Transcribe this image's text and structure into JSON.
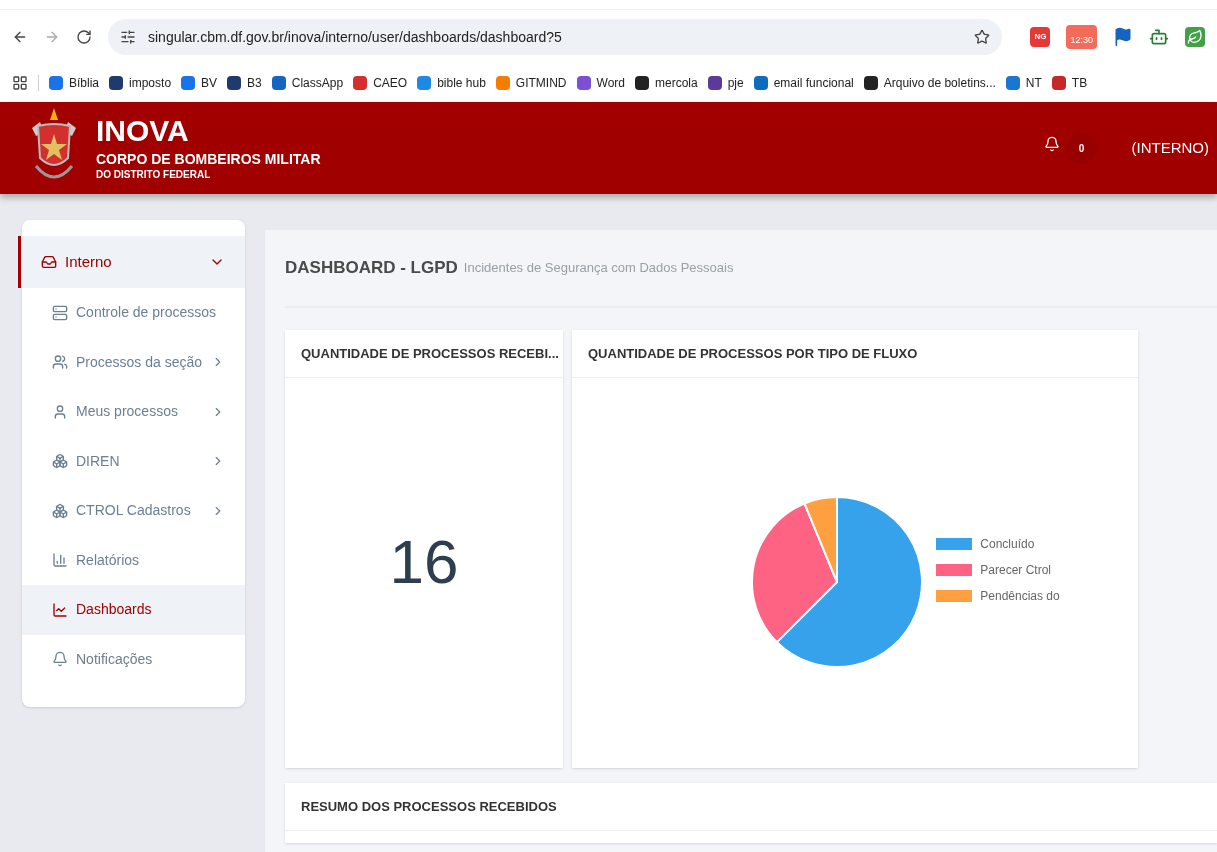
{
  "browser": {
    "url": "singular.cbm.df.gov.br/inova/interno/user/dashboards/dashboard?5",
    "extensions": [
      {
        "kind": "badge",
        "label": "NG"
      },
      {
        "kind": "clock",
        "label": "12:30"
      },
      {
        "kind": "flag"
      },
      {
        "kind": "robot"
      },
      {
        "kind": "leaf"
      }
    ],
    "bookmarks": [
      {
        "label": "Bíblia",
        "color": "#1a73e8"
      },
      {
        "label": "imposto",
        "color": "#1f3b6e"
      },
      {
        "label": "BV",
        "color": "#1a73e8"
      },
      {
        "label": "B3",
        "color": "#1f3b6e"
      },
      {
        "label": "ClassApp",
        "color": "#1565c0"
      },
      {
        "label": "CAEO",
        "color": "#d32f2f"
      },
      {
        "label": "bible hub",
        "color": "#1e88e5"
      },
      {
        "label": "GITMIND",
        "color": "#f57c00"
      },
      {
        "label": "Word",
        "color": "#7b4fd6"
      },
      {
        "label": "mercola",
        "color": "#222222"
      },
      {
        "label": "pje",
        "color": "#5b3a99"
      },
      {
        "label": "email funcional",
        "color": "#0f6cbd"
      },
      {
        "label": "Arquivo de boletins...",
        "color": "#222222"
      },
      {
        "label": "NT",
        "color": "#1976d2"
      },
      {
        "label": "TB",
        "color": "#c62828"
      }
    ]
  },
  "header": {
    "title": "INOVA",
    "subtitle": "CORPO DE BOMBEIROS MILITAR",
    "subtitle2": "DO DISTRITO FEDERAL",
    "notification_count": "0",
    "user": "(INTERNO)"
  },
  "sidebar": {
    "group": {
      "label": "Interno",
      "expanded": true
    },
    "items": [
      {
        "label": "Controle de processos",
        "has_children": false,
        "selected": false
      },
      {
        "label": "Processos da seção",
        "has_children": true,
        "selected": false
      },
      {
        "label": "Meus processos",
        "has_children": true,
        "selected": false
      },
      {
        "label": "DIREN",
        "has_children": true,
        "selected": false
      },
      {
        "label": "CTROL Cadastros",
        "has_children": true,
        "selected": false
      },
      {
        "label": "Relatórios",
        "has_children": false,
        "selected": false
      },
      {
        "label": "Dashboards",
        "has_children": false,
        "selected": true
      },
      {
        "label": "Notificações",
        "has_children": false,
        "selected": false
      }
    ]
  },
  "page": {
    "title": "DASHBOARD - LGPD",
    "subtitle": "Incidentes de Segurança com Dados Pessoais"
  },
  "cards": [
    {
      "title": "QUANTIDADE DE PROCESSOS RECEBI...",
      "value": "16"
    },
    {
      "title": "QUANTIDADE DE PROCESSOS POR TIPO DE FLUXO",
      "chart_data": {
        "type": "pie",
        "categories": [
          "Concluído",
          "Parecer Ctrol",
          "Pendências do"
        ],
        "values": [
          62.5,
          31.25,
          6.25
        ],
        "colors": [
          "#36a2eb",
          "#ff6384",
          "#ff9f40"
        ],
        "legend": "right"
      }
    },
    {
      "title": "RESUMO DOS PROCESSOS RECEBIDOS"
    }
  ]
}
